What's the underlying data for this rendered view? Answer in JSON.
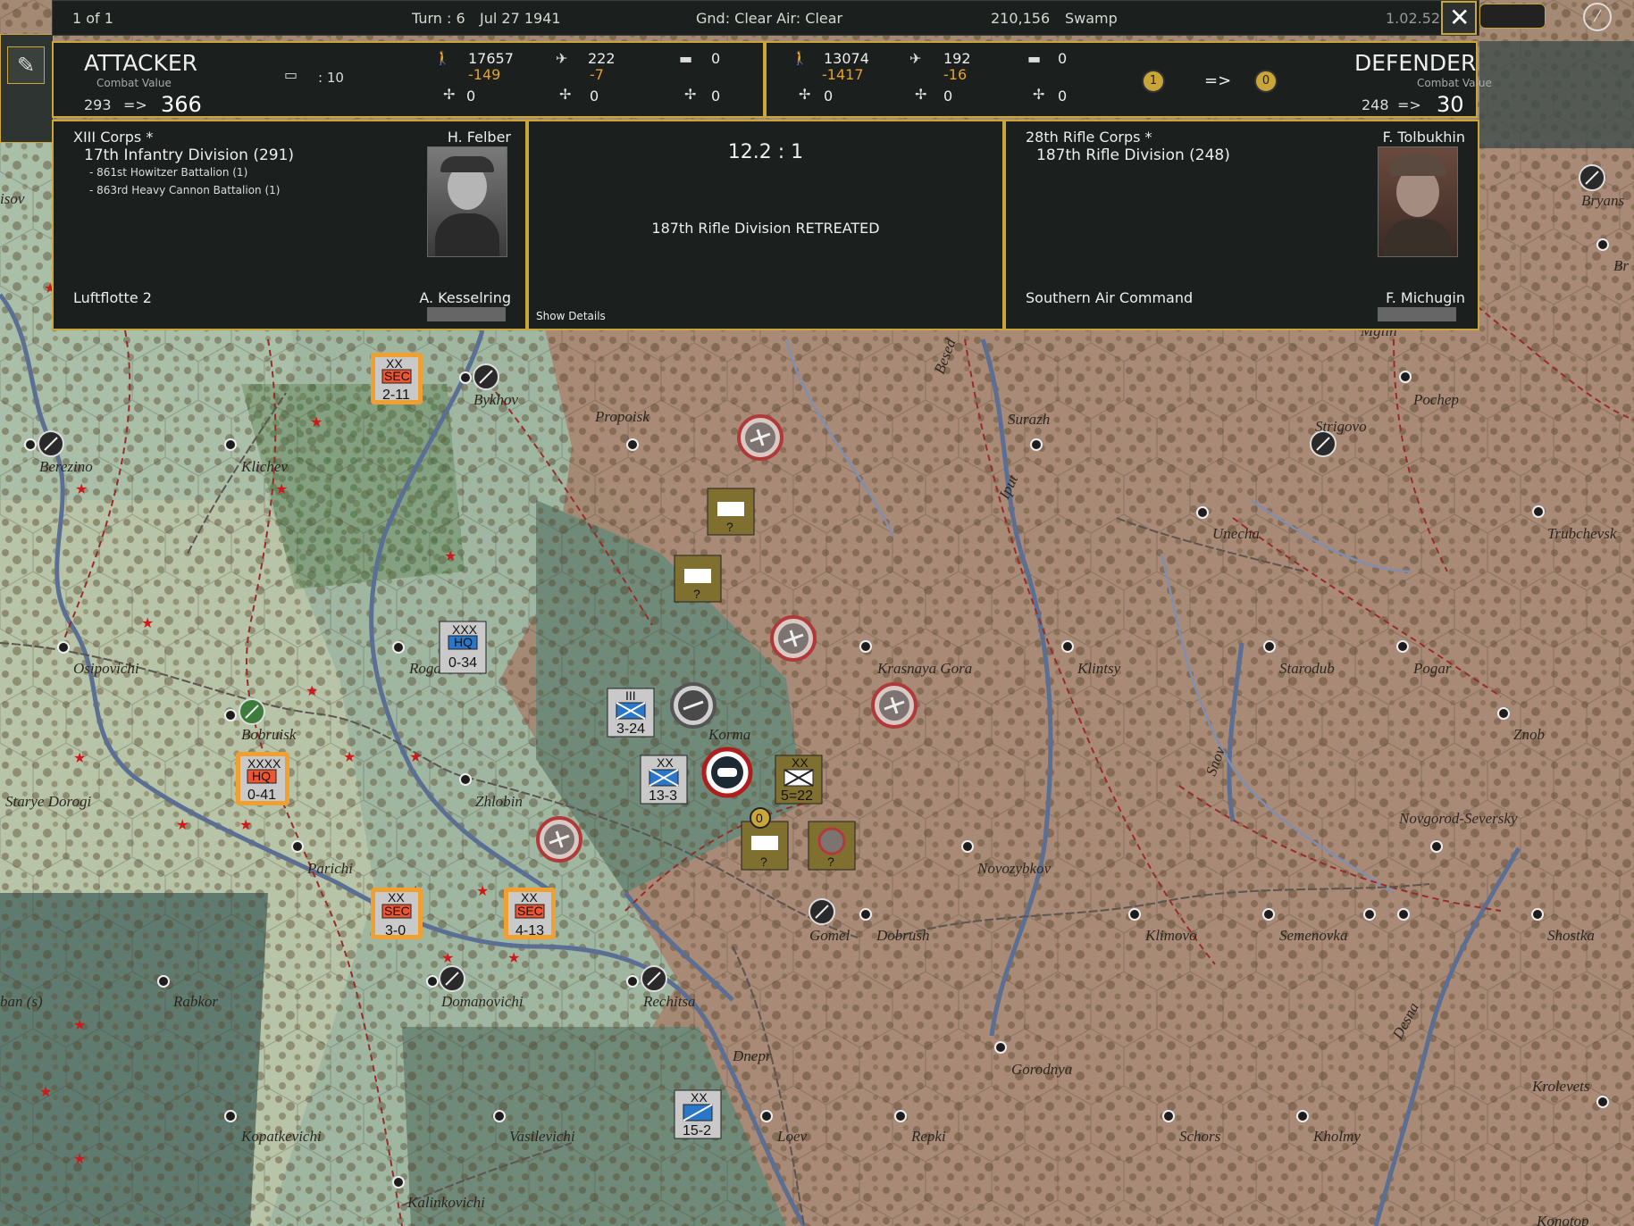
{
  "topbar": {
    "page": "1 of 1",
    "turn": "Turn : 6",
    "date": "Jul 27 1941",
    "weather": "Gnd: Clear  Air: Clear",
    "hex_info": "210,156",
    "terrain": "Swamp",
    "version": "1.02.52"
  },
  "attacker": {
    "title": "ATTACKER",
    "cv_label": "Combat Value",
    "cv_before": "293",
    "arrow": "=>",
    "cv_after": "366",
    "ammo": ": 10",
    "men": "17657",
    "men_loss": "-149",
    "air": "222",
    "air_loss": "-7",
    "tanks": "0",
    "r1": "0",
    "r2": "0",
    "r3": "0",
    "corps": "XIII Corps *",
    "division": "17th Infantry Division (291)",
    "sub1": "- 861st Howitzer Battalion (1)",
    "sub2": "- 863rd Heavy Cannon Battalion (1)",
    "commander": "H. Felber",
    "air_unit": "Luftflotte 2",
    "air_commander": "A. Kesselring"
  },
  "defender": {
    "title": "DEFENDER",
    "cv_label": "Combat Value",
    "cv_before": "248",
    "arrow": "=>",
    "cv_after": "30",
    "men": "13074",
    "men_loss": "-1417",
    "air": "192",
    "air_loss": "-16",
    "tanks": "0",
    "r1": "0",
    "r2": "0",
    "r3": "0",
    "fort_before": "1",
    "fort_arrow": "=>",
    "fort_after": "0",
    "corps": "28th Rifle Corps *",
    "division": "187th Rifle Division (248)",
    "commander": "F. Tolbukhin",
    "air_unit": "Southern Air Command",
    "air_commander": "F. Michugin"
  },
  "result": {
    "odds": "12.2 : 1",
    "message": "187th Rifle Division RETREATED",
    "show_details": "Show Details"
  },
  "map": {
    "towns": [
      "Bykhov",
      "Propoisk",
      "Surazh",
      "Pochep",
      "Berezino",
      "Klichev",
      "Strigovo",
      "Unecha",
      "Trubchevsk",
      "Osipovichi",
      "Rogach",
      "Krasnaya Gora",
      "Klintsy",
      "Starodub",
      "Pogar",
      "Bobruisk",
      "Korma",
      "Znob",
      "Starye Dorogi",
      "Zhlobin",
      "Novgorod-Seversky",
      "Parichi",
      "Novozybkov",
      "Gomel",
      "Dobrush",
      "Klimovo",
      "Semenovka",
      "Shostka",
      "Rabkor",
      "Domanovichi",
      "Rechitsa",
      "Desna",
      "Dnepr",
      "Gorodnya",
      "Krolevets",
      "Kopatkevichi",
      "Vasilevichi",
      "Loev",
      "Repki",
      "Schors",
      "Kholmy",
      "Kalinkovichi",
      "Konotop",
      "isov",
      "Bryans",
      "Mglin",
      "Iput",
      "Snov",
      "Besed",
      "ban (s)",
      "Br"
    ],
    "units": [
      {
        "code": "2-11",
        "type": "SEC",
        "size": "XX"
      },
      {
        "code": "0-34",
        "type": "HQ",
        "size": "XXX"
      },
      {
        "code": "0-41",
        "type": "HQ",
        "size": "XXXX"
      },
      {
        "code": "3-0",
        "type": "SEC",
        "size": "XX"
      },
      {
        "code": "4-13",
        "type": "SEC",
        "size": "XX"
      },
      {
        "code": "3-24",
        "size": "III"
      },
      {
        "code": "13-3",
        "size": "XX"
      },
      {
        "code": "5=22",
        "size": "XX"
      },
      {
        "code": "15-2",
        "size": "XX"
      },
      {
        "code": "?"
      }
    ],
    "marker_value": "0"
  }
}
